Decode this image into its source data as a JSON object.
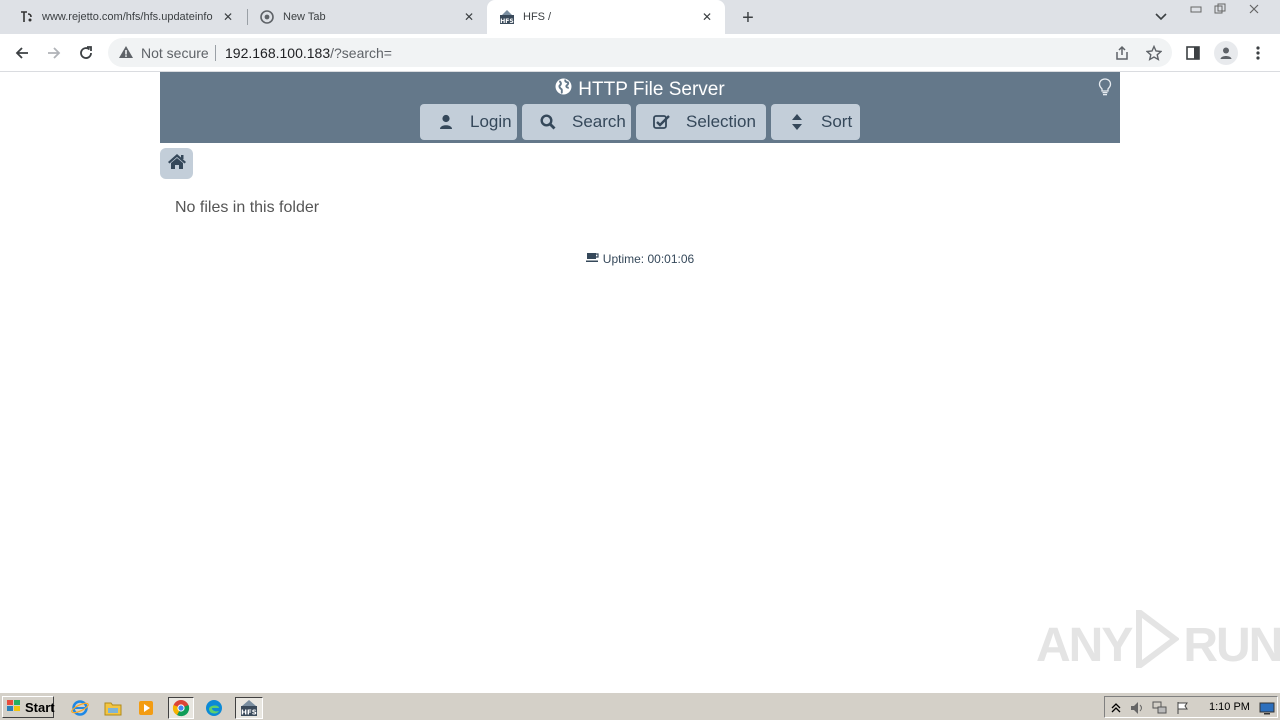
{
  "browser": {
    "tabs": [
      {
        "title": "www.rejetto.com/hfs/hfs.updateinfo",
        "active": false,
        "icon": "rejetto-favicon"
      },
      {
        "title": "New Tab",
        "active": false,
        "icon": "chrome-icon"
      },
      {
        "title": "HFS /",
        "active": true,
        "icon": "hfs-favicon"
      }
    ],
    "security_label": "Not secure",
    "url_host": "192.168.100.183",
    "url_path": "/?search="
  },
  "hfs": {
    "title": "HTTP File Server",
    "buttons": {
      "login": "Login",
      "search": "Search",
      "selection": "Selection",
      "sort": "Sort"
    },
    "empty_message": "No files in this folder",
    "uptime": "Uptime: 00:01:06",
    "header_color": "#64788a",
    "button_color": "#c3ced9"
  },
  "watermark": {
    "left": "ANY",
    "right": "RUN"
  },
  "taskbar": {
    "start_label": "Start",
    "clock": "1:10 PM"
  }
}
